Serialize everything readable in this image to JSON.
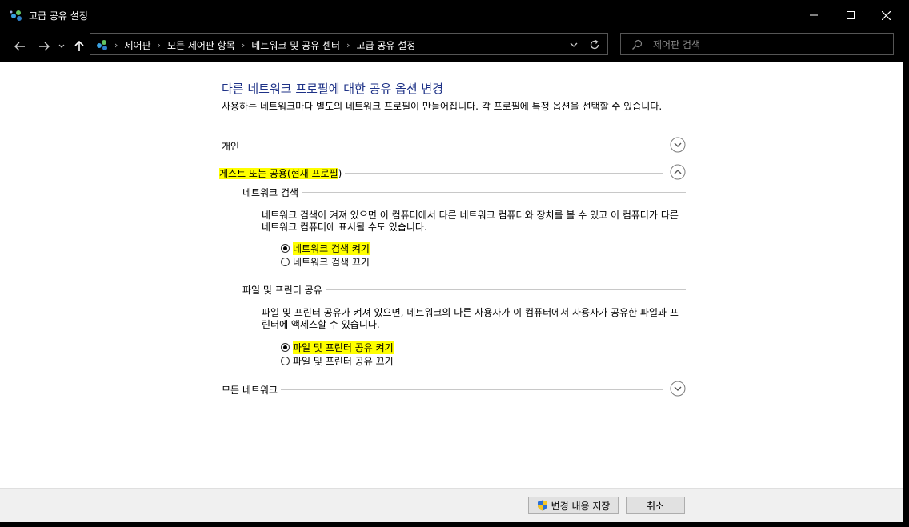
{
  "window": {
    "title": "고급 공유 설정"
  },
  "address": {
    "crumbs": [
      "제어판",
      "모든 제어판 항목",
      "네트워크 및 공유 센터",
      "고급 공유 설정"
    ],
    "search_placeholder": "제어판 검색"
  },
  "content": {
    "heading": "다른 네트워크 프로필에 대한 공유 옵션 변경",
    "description": "사용하는 네트워크마다 별도의 네트워크 프로필이 만들어집니다. 각 프로필에 특정 옵션을 선택할 수 있습니다.",
    "profiles": {
      "private": {
        "label": "개인",
        "expanded": false
      },
      "guest": {
        "label_highlight": "게스트 또는 공용(현재 프로필",
        "label_rest": ")",
        "expanded": true,
        "network_discovery": {
          "label": "네트워크 검색",
          "description": "네트워크 검색이 켜져 있으면 이 컴퓨터에서 다른 네트워크 컴퓨터와 장치를 볼 수 있고 이 컴퓨터가 다른 네트워크 컴퓨터에 표시될 수도 있습니다.",
          "options": [
            {
              "label": "네트워크 검색 켜기",
              "checked": true,
              "highlight": true
            },
            {
              "label": "네트워크 검색 끄기",
              "checked": false,
              "highlight": false
            }
          ]
        },
        "file_printer_sharing": {
          "label": "파일 및 프린터 공유",
          "description": "파일 및 프린터 공유가 켜져 있으면, 네트워크의 다른 사용자가 이 컴퓨터에서 사용자가 공유한 파일과 프린터에 액세스할 수 있습니다.",
          "options": [
            {
              "label": "파일 및 프린터 공유 켜기",
              "checked": true,
              "highlight": true
            },
            {
              "label": "파일 및 프린터 공유 끄기",
              "checked": false,
              "highlight": false
            }
          ]
        }
      },
      "all": {
        "label": "모든 네트워크",
        "expanded": false
      }
    }
  },
  "footer": {
    "save_label": "변경 내용 저장",
    "cancel_label": "취소"
  },
  "colors": {
    "heading": "#1e3287",
    "highlight": "#ffff00",
    "titlebar": "#000000"
  },
  "icons": {
    "app": "network-sharing-icon",
    "nav": [
      "back-arrow-icon",
      "forward-arrow-icon",
      "recent-dropdown-icon",
      "up-arrow-icon"
    ],
    "save": "uac-shield-icon"
  }
}
